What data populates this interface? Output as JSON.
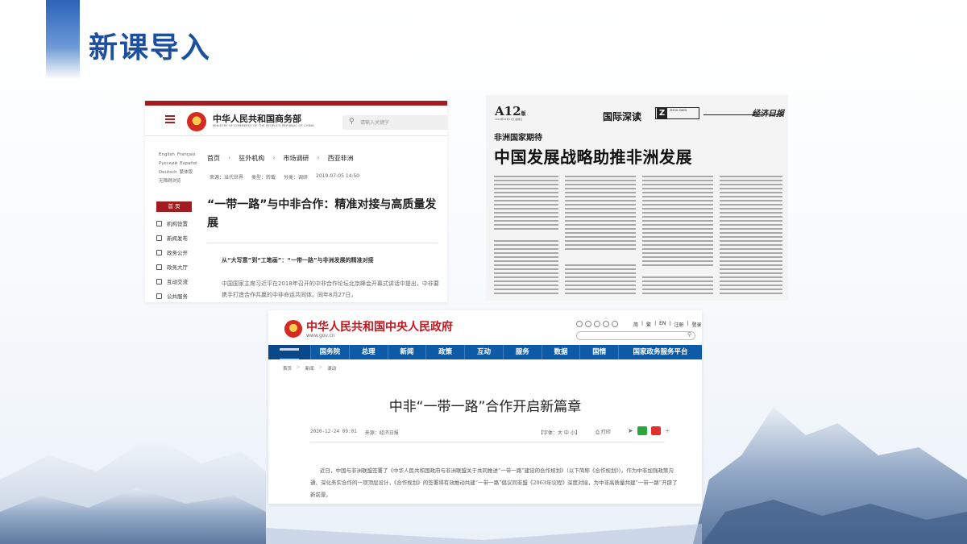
{
  "slide": {
    "title": "新课导入"
  },
  "mofcom": {
    "site_name": "中华人民共和国商务部",
    "site_name_en": "MINISTRY OF COMMERCE OF THE PEOPLE'S REPUBLIC OF CHINA",
    "search_placeholder": "请输入关键字",
    "languages": [
      "English",
      "Français",
      "Русский",
      "Español",
      "Deutsch",
      "繁体版",
      "无障碍浏览"
    ],
    "home_label": "首 页",
    "side_menu": [
      "机构设置",
      "新闻发布",
      "政务公开",
      "政务大厅",
      "互动交流",
      "公共服务"
    ],
    "breadcrumb": [
      "首页",
      "驻外机构",
      "市场调研",
      "西亚非洲"
    ],
    "meta": {
      "source": "来源：当代世界",
      "type": "类型：转载",
      "category": "分类：调研",
      "date": "2019-07-05 14:50"
    },
    "title": "“一带一路”与中非合作：精准对接与高质量发展",
    "subtitle": "从“大写意”到“工笔画”：“一带一路”与非洲发展的精准对接",
    "body": "中国国家主席习近平在2018年召开的中非合作论坛北京峰会开幕式讲话中提出，中非要携手打造合作共赢的中非命运共同体。同年8月27日，"
  },
  "newspaper": {
    "page_no": "A12",
    "page_no_suffix": "版",
    "page_date": "2019年10月11日 星期五",
    "section": "国际深读",
    "logo_letter": "Z",
    "logo_text": "ZHOU SHEN",
    "masthead": "经济日报",
    "kicker": "非洲国家期待",
    "headline": "中国发展战略助推非洲发展"
  },
  "gov": {
    "site_name": "中华人民共和国中央人民政府",
    "url": "www.gov.cn",
    "tool_links": [
      "简",
      "繁",
      "EN",
      "注册",
      "登录"
    ],
    "nav": [
      "国务院",
      "总理",
      "新闻",
      "政策",
      "互动",
      "服务",
      "数据",
      "国情",
      "国家政务服务平台"
    ],
    "breadcrumb": [
      "首页",
      "新闻",
      "滚动"
    ],
    "title": "中非“一带一路”合作开启新篇章",
    "date": "2020-12-24 09:01",
    "source": "来源：经济日报",
    "font_size_label": "【字体：大 中 小】",
    "print_label": "打印",
    "body": "近日，中国与非洲联盟签署了《中华人民共和国政府与非洲联盟关于共同推进“一带一路”建设的合作规划》（以下简称《合作规划》）。作为中非加强政策沟通、深化务实合作的一项顶层设计，《合作规划》的签署将有效推动共建“一带一路”倡议同非盟《2063年议程》深度对接，为中非高质量共建“一带一路”开辟了新前景。"
  }
}
